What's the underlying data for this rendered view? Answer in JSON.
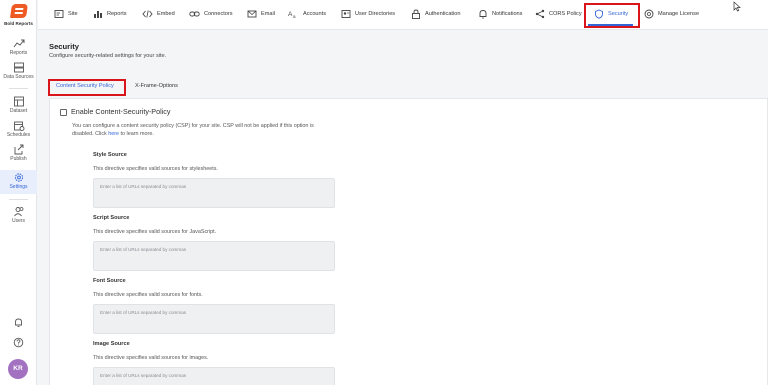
{
  "brand": {
    "name": "Bold Reports"
  },
  "sidebar": {
    "items": [
      {
        "label": "Reports",
        "icon": "reports-trend-icon"
      },
      {
        "label": "Data Sources",
        "icon": "data-sources-icon"
      },
      {
        "label": "Dataset",
        "icon": "dataset-icon"
      },
      {
        "label": "Schedules",
        "icon": "schedules-icon"
      },
      {
        "label": "Publish",
        "icon": "publish-icon"
      },
      {
        "label": "Settings",
        "icon": "settings-gear-icon",
        "active": true
      },
      {
        "label": "Users",
        "icon": "users-icon"
      }
    ],
    "avatar_initials": "KR",
    "avatar_color": "#a271c0"
  },
  "topnav": {
    "tabs": [
      {
        "label": "Site",
        "icon": "site-icon"
      },
      {
        "label": "Reports",
        "icon": "bar-chart-icon"
      },
      {
        "label": "Embed",
        "icon": "code-icon"
      },
      {
        "label": "Connectors",
        "icon": "link-icon"
      },
      {
        "label": "Email",
        "icon": "mail-icon"
      },
      {
        "label": "Accounts",
        "icon": "accounts-icon"
      },
      {
        "label": "User Directories",
        "icon": "directory-icon"
      },
      {
        "label": "Authentication",
        "icon": "lock-icon"
      },
      {
        "label": "Notifications",
        "icon": "bell-icon"
      },
      {
        "label": "CORS Policy",
        "icon": "share-icon"
      },
      {
        "label": "Security",
        "icon": "shield-icon",
        "active": true
      },
      {
        "label": "Manage License",
        "icon": "license-icon"
      }
    ]
  },
  "page": {
    "title": "Security",
    "subtitle": "Configure security-related settings for your site."
  },
  "inner_tabs": [
    {
      "label": "Content Security Policy",
      "active": true
    },
    {
      "label": "X-Frame-Options"
    }
  ],
  "csp": {
    "checkbox_label": "Enable Content-Security-Policy",
    "checked": false,
    "desc_before": "You can configure a content security policy (CSP) for your site. CSP will not be applied if this option is disabled. Click ",
    "link_text": "here",
    "desc_after": " to learn more."
  },
  "sources": [
    {
      "title": "Style Source",
      "desc": "This directive specifies valid sources for stylesheets.",
      "placeholder": "Enter a list of URLs separated by commas"
    },
    {
      "title": "Script Source",
      "desc": "This directive specifies valid sources for JavaScript.",
      "placeholder": "Enter a list of URLs separated by commas"
    },
    {
      "title": "Font Source",
      "desc": "This directive specifies valid sources for fonts.",
      "placeholder": "Enter a list of URLs separated by commas"
    },
    {
      "title": "Image Source",
      "desc": "This directive specifies valid sources for images.",
      "placeholder": "Enter a list of URLs separated by commas"
    }
  ],
  "colors": {
    "accent": "#3365d6",
    "highlight": "#d9141b",
    "brand": "#ee5a24"
  }
}
